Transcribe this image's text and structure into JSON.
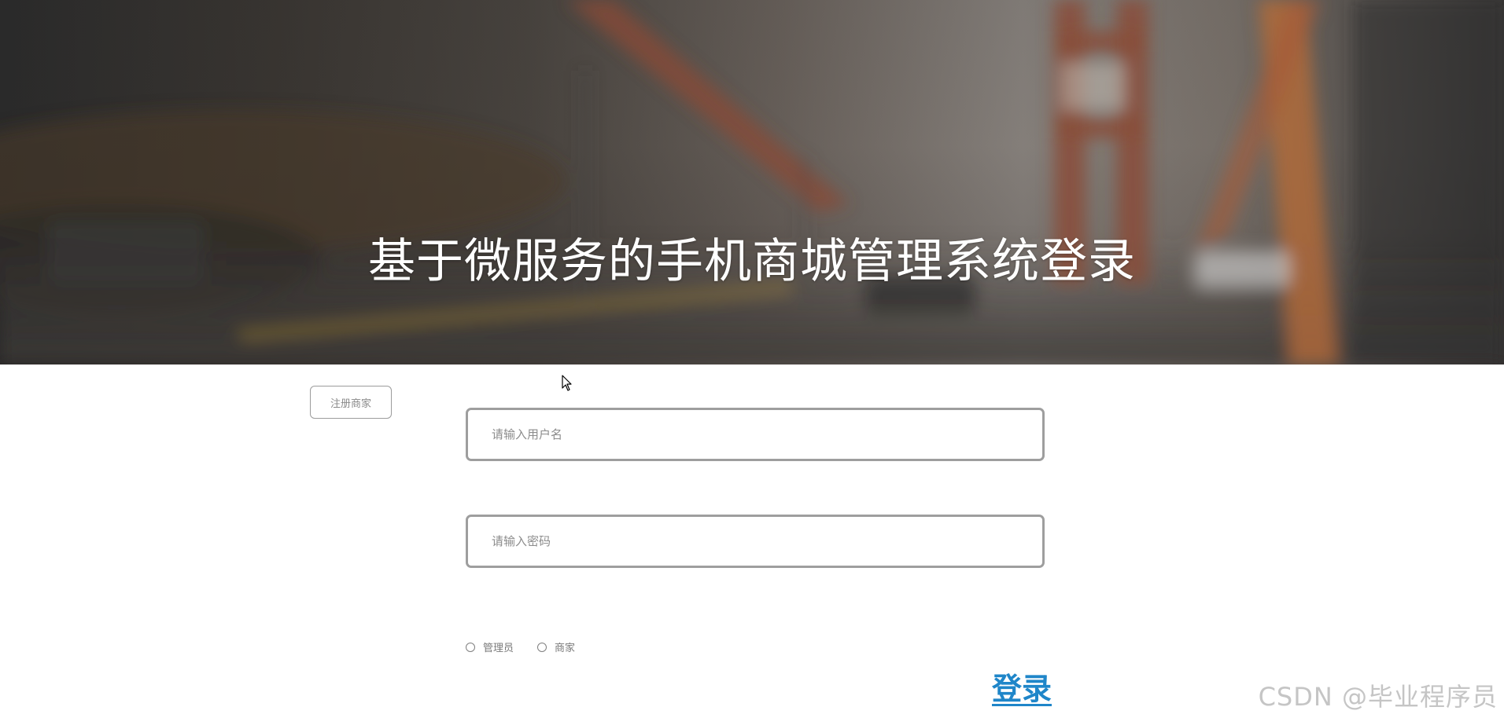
{
  "hero": {
    "title": "基于微服务的手机商城管理系统登录"
  },
  "register_button": {
    "label": "注册商家"
  },
  "login_form": {
    "username": {
      "value": "",
      "placeholder": "请输入用户名"
    },
    "password": {
      "value": "",
      "placeholder": "请输入密码"
    },
    "roles": [
      {
        "label": "管理员",
        "selected": false
      },
      {
        "label": "商家",
        "selected": false
      }
    ],
    "submit_label": "登录"
  },
  "watermark": "CSDN @毕业程序员",
  "colors": {
    "accent": "#1f86c9",
    "input_border": "#9e9e9e",
    "hero_text": "#ffffff"
  },
  "icons": {
    "cursor": "mouse-pointer-icon",
    "radio": "radio-unchecked-icon"
  }
}
